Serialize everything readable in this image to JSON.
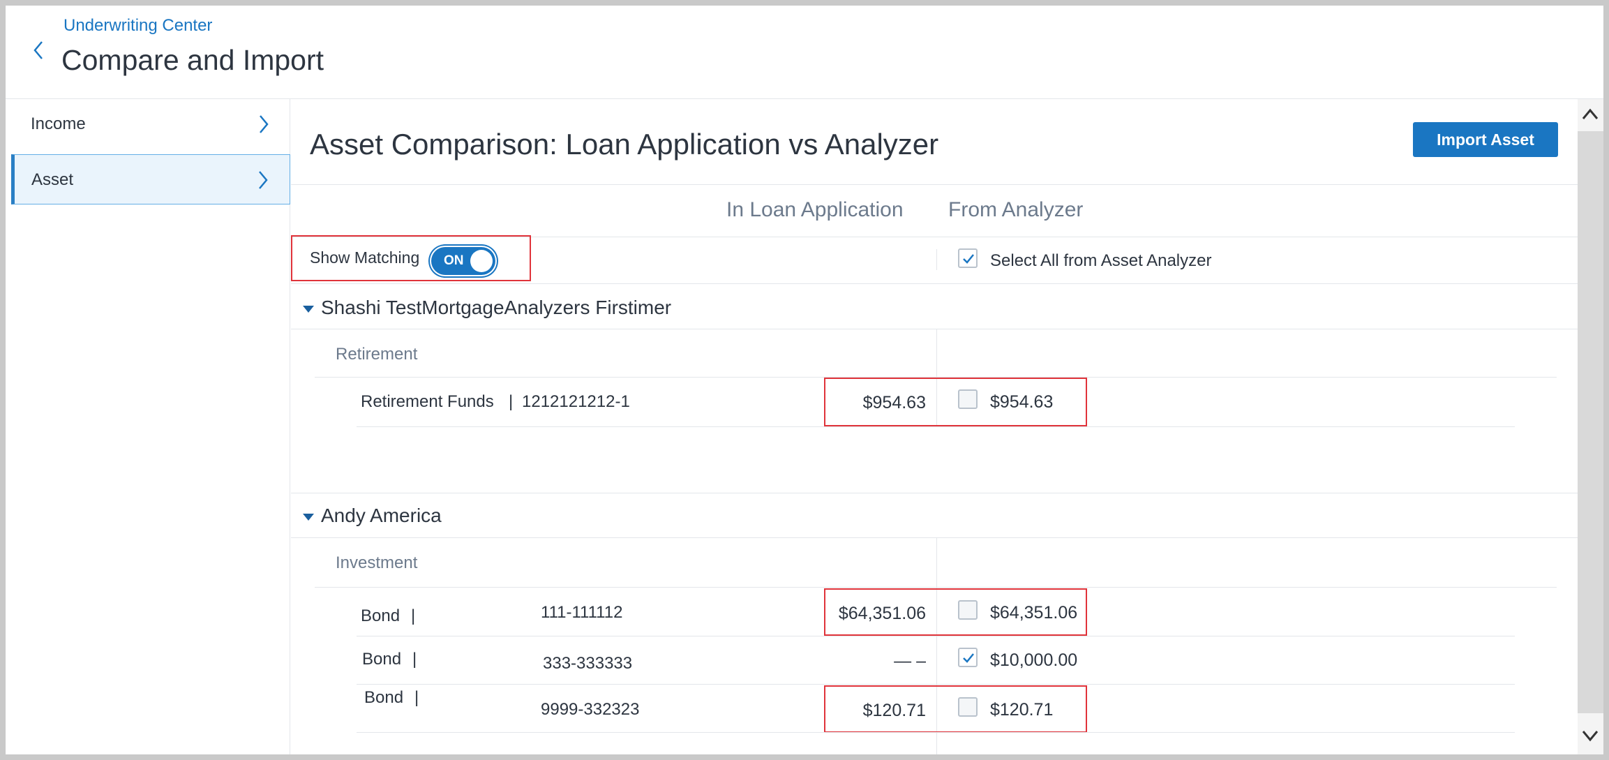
{
  "header": {
    "breadcrumb": "Underwriting Center",
    "title": "Compare and Import"
  },
  "sidebar": {
    "items": [
      {
        "label": "Income"
      },
      {
        "label": "Asset"
      }
    ]
  },
  "main": {
    "title": "Asset Comparison: Loan Application vs Analyzer",
    "import_button": "Import Asset",
    "col_loan_app": "In Loan Application",
    "col_analyzer": "From Analyzer",
    "show_matching_label": "Show Matching",
    "toggle_state": "ON",
    "select_all_label": "Select All from Asset Analyzer",
    "select_all_checked": true
  },
  "groups": [
    {
      "owner": "Shashi TestMortgageAnalyzers Firstimer",
      "category": "Retirement",
      "rows": [
        {
          "asset_type": "Retirement Funds",
          "separator": "|",
          "account": "1212121212-1",
          "loan_app_value": "$954.63",
          "analyzer_value": "$954.63",
          "checked": false
        }
      ]
    },
    {
      "owner": "Andy America",
      "category": "Investment",
      "rows": [
        {
          "asset_type": "Bond",
          "separator": "|",
          "account": "111-111112",
          "loan_app_value": "$64,351.06",
          "analyzer_value": "$64,351.06",
          "checked": false
        },
        {
          "asset_type": "Bond",
          "separator": "|",
          "account": "333-333333",
          "loan_app_value": "— –",
          "analyzer_value": "$10,000.00",
          "checked": true
        },
        {
          "asset_type": "Bond",
          "separator": "|",
          "account": "9999-332323",
          "loan_app_value": "$120.71",
          "analyzer_value": "$120.71",
          "checked": false
        }
      ]
    }
  ],
  "colors": {
    "accent": "#1a76c2",
    "highlight_box": "#e0333a",
    "sidebar_active_bg": "#eaf4fc",
    "text_primary": "#2d3540",
    "text_secondary": "#6c7a8c"
  },
  "icons": {
    "back": "chevron-left-icon",
    "sidebar_chevron": "chevron-right-icon",
    "group_caret": "caret-down-icon",
    "checkbox_check": "check-icon",
    "scroll_up": "chevron-up-icon",
    "scroll_down": "chevron-down-icon"
  }
}
